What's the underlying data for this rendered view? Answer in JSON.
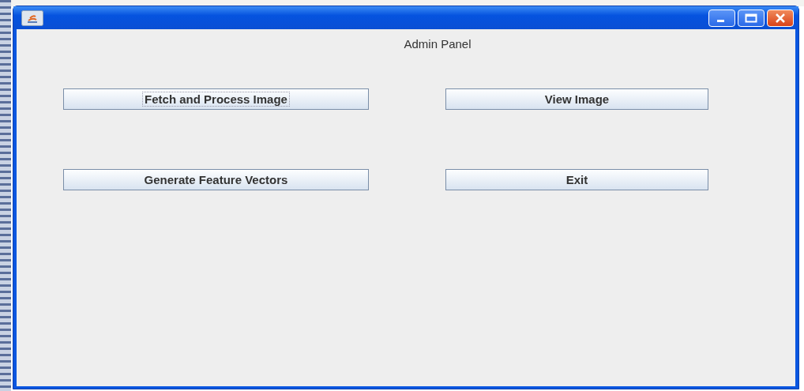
{
  "heading": "Admin Panel",
  "buttons": [
    {
      "label": "Fetch and Process Image",
      "focused": true
    },
    {
      "label": "View Image",
      "focused": false
    },
    {
      "label": "Generate Feature Vectors",
      "focused": false
    },
    {
      "label": "Exit",
      "focused": false
    }
  ]
}
